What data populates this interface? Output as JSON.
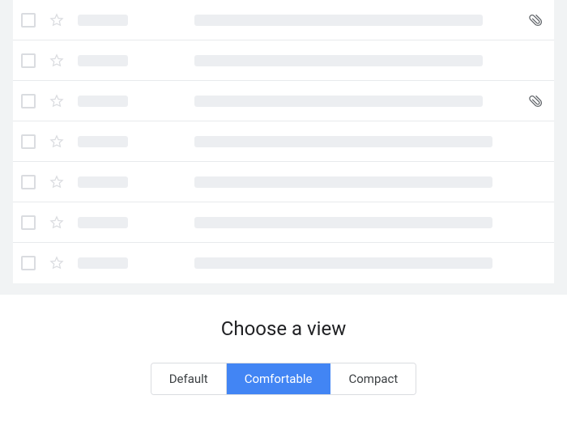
{
  "preview": {
    "rows": [
      {
        "subject_width": 356,
        "has_attachment": true
      },
      {
        "subject_width": 356,
        "has_attachment": false
      },
      {
        "subject_width": 356,
        "has_attachment": true
      },
      {
        "subject_width": 368,
        "has_attachment": false
      },
      {
        "subject_width": 368,
        "has_attachment": false
      },
      {
        "subject_width": 368,
        "has_attachment": false
      },
      {
        "subject_width": 368,
        "has_attachment": false
      }
    ]
  },
  "chooser": {
    "title": "Choose a view",
    "options": [
      "Default",
      "Comfortable",
      "Compact"
    ],
    "selected": "Comfortable"
  },
  "icons": {
    "star": "star-outline-icon",
    "attachment": "attachment-icon"
  },
  "colors": {
    "accent": "#4285f4",
    "border": "#dadce0",
    "placeholder": "#eceef1",
    "preview_bg": "#f1f3f4"
  }
}
